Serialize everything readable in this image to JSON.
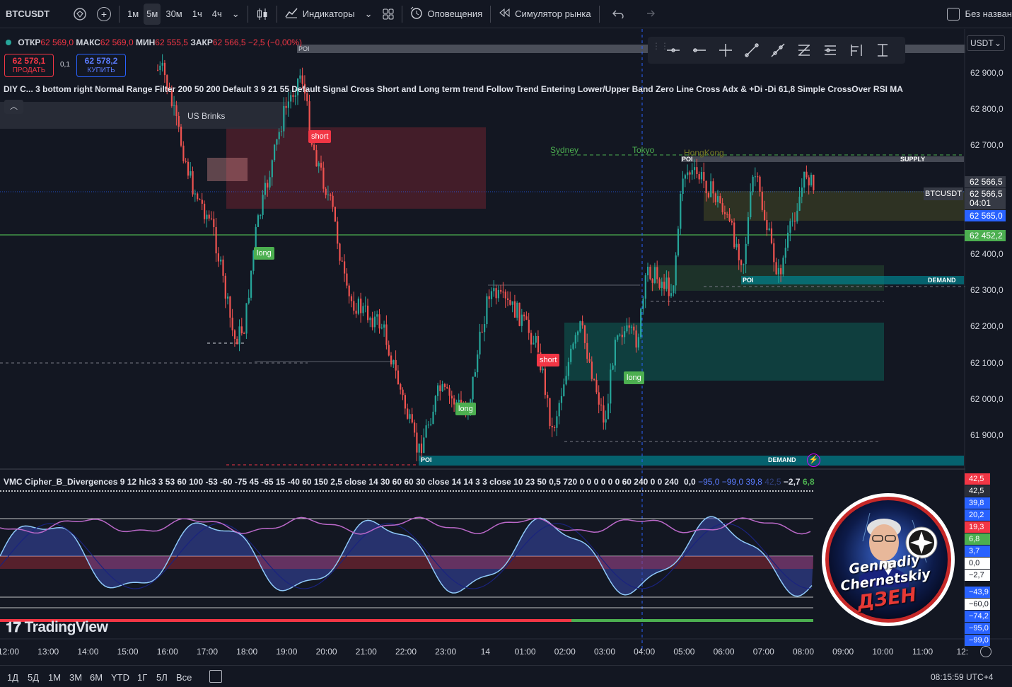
{
  "toolbar": {
    "symbol": "BTCUSDT",
    "timeframes": [
      "1м",
      "5м",
      "30м",
      "1ч",
      "4ч"
    ],
    "active_timeframe": "5м",
    "indicators_label": "Индикаторы",
    "alerts_label": "Оповещения",
    "replay_label": "Симулятор рынка",
    "layout_name": "Без назван"
  },
  "legend": {
    "open_label": "ОТКР",
    "open": "62 569,0",
    "high_label": "МАКС",
    "high": "62 569,0",
    "low_label": "МИН",
    "low": "62 555,5",
    "close_label": "ЗАКР",
    "close": "62 566,5",
    "change": "−2,5 (−0,00%)"
  },
  "trade": {
    "sell_price": "62 578,1",
    "sell_label": "ПРОДАТЬ",
    "spread": "0,1",
    "buy_price": "62 578,2",
    "buy_label": "КУПИТЬ"
  },
  "indicator_legend": "DIY C... 3 bottom right Normal Range Filter 200 50 200 Default 3 9 21 55 Default Signal Cross Short and Long term trend Follow Trend Entering Lower/Upper Band Zero Line Cross Adx & +Di -Di 61,8 Simple CrossOver RSI MA",
  "vmc_legend": {
    "text": "VMC Cipher_B_Divergences 9 12 hlc3 3 53 60 100 -53 -60 -75 45 -65 15 -40 60 150 2,5 close 14 30 60 60 30 close 14 14 3 3 close 10 23 50 0,5 720 0 0 0 0 0 0 60 240 0 0 240",
    "v1": "0,0",
    "v2": "−95,0",
    "v3": "−99,0",
    "v4": "39,8",
    "v5": "42,5",
    "v6": "−2,7",
    "v7": "6,8"
  },
  "price_scale": {
    "currency": "USDT",
    "ticks": [
      "62 900,0",
      "62 800,0",
      "62 700,0",
      "62 400,0",
      "62 300,0",
      "62 200,0",
      "62 100,0",
      "62 000,0",
      "61 900,0"
    ],
    "last_price_1": "62 566,5",
    "symbol_tag": "BTCUSDT",
    "last_price_2": "62 566,5",
    "countdown": "04:01",
    "bid_price": "62 565,0",
    "green_line_price": "62 452,2"
  },
  "osc_scale": [
    {
      "v": "42,5",
      "bg": "#f23645",
      "fg": "#ffffff"
    },
    {
      "v": "42,5",
      "bg": "#2a2e39",
      "fg": "#ffffff"
    },
    {
      "v": "39,8",
      "bg": "#2962ff",
      "fg": "#ffffff"
    },
    {
      "v": "20,2",
      "bg": "#2962ff",
      "fg": "#ffffff"
    },
    {
      "v": "19,3",
      "bg": "#f23645",
      "fg": "#ffffff"
    },
    {
      "v": "6,8",
      "bg": "#4caf50",
      "fg": "#ffffff"
    },
    {
      "v": "3,7",
      "bg": "#2962ff",
      "fg": "#ffffff"
    },
    {
      "v": "0,0",
      "bg": "#ffffff",
      "fg": "#131722"
    },
    {
      "v": "−2,7",
      "bg": "#ffffff",
      "fg": "#131722"
    },
    {
      "v": "−43,9",
      "bg": "#2962ff",
      "fg": "#ffffff"
    },
    {
      "v": "−60,0",
      "bg": "#ffffff",
      "fg": "#131722"
    },
    {
      "v": "−74,2",
      "bg": "#2962ff",
      "fg": "#ffffff"
    },
    {
      "v": "−95,0",
      "bg": "#2962ff",
      "fg": "#ffffff"
    },
    {
      "v": "−99,0",
      "bg": "#2962ff",
      "fg": "#ffffff"
    }
  ],
  "chart_labels": {
    "poi": "POI",
    "supply": "SUPPLY",
    "demand": "DEMAND",
    "us_brinks": "US Brinks",
    "sydney": "Sydney",
    "tokyo": "Tokyo",
    "hongkong": "HongKong",
    "short": "short",
    "long": "long"
  },
  "time_axis": [
    "12:00",
    "13:00",
    "14:00",
    "15:00",
    "16:00",
    "17:00",
    "18:00",
    "19:00",
    "20:00",
    "21:00",
    "22:00",
    "23:00",
    "14",
    "01:00",
    "02:00",
    "03:00",
    "04:00",
    "05:00",
    "06:00",
    "07:00",
    "08:00",
    "09:00",
    "10:00",
    "11:00",
    "12:"
  ],
  "bottom": {
    "ranges": [
      "1Д",
      "5Д",
      "1М",
      "3М",
      "6М",
      "YTD",
      "1Г",
      "5Л",
      "Все"
    ],
    "clock": "08:15:59 UTC+4"
  },
  "watermark": "TradingView",
  "badge": {
    "line1": "Gennadiy",
    "line2": "Chernetskiy",
    "line3": "ДЗЕН"
  },
  "colors": {
    "bull": "#26a69a",
    "bear": "#ef5350",
    "accent": "#2962ff",
    "green_line": "#4caf50"
  }
}
